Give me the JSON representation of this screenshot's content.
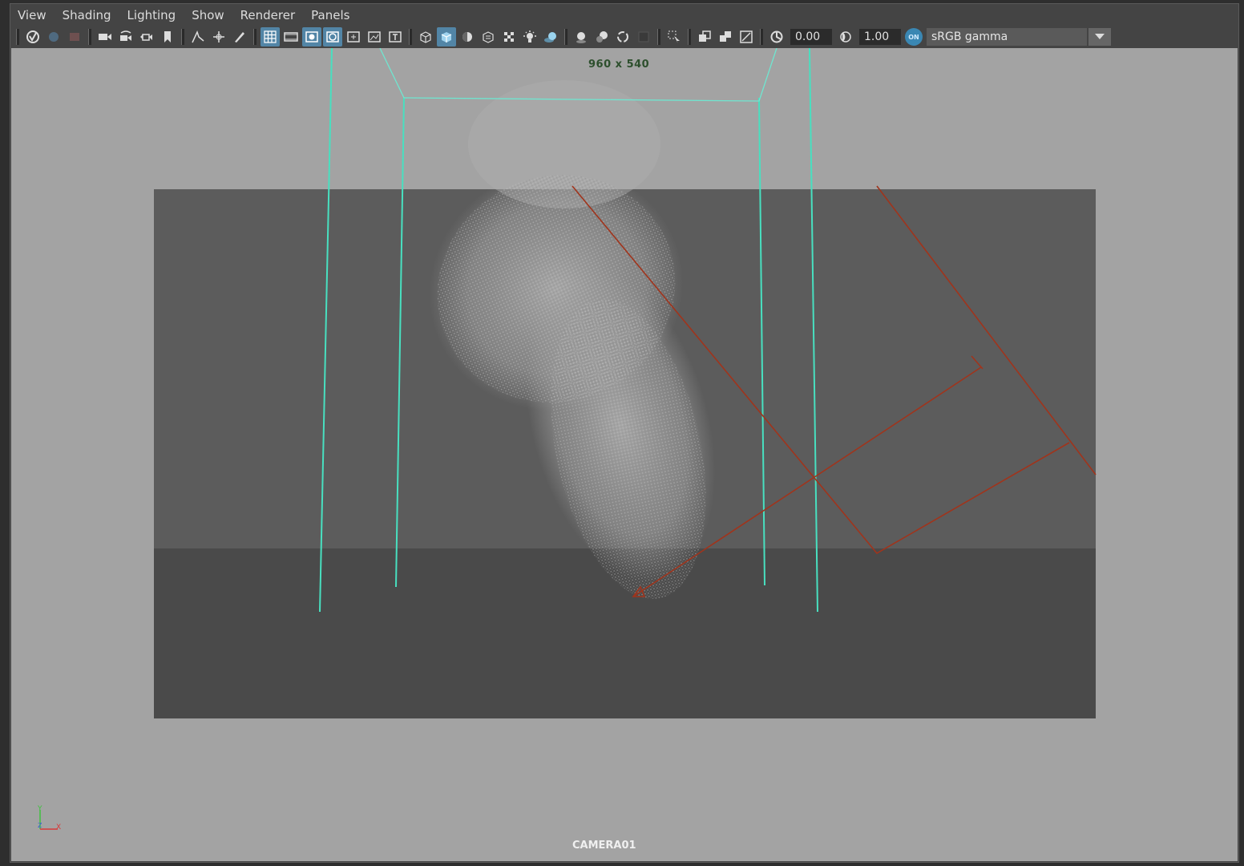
{
  "menu": {
    "items": [
      "View",
      "Shading",
      "Lighting",
      "Show",
      "Renderer",
      "Panels"
    ]
  },
  "toolbar": {
    "exposure_value": "0.00",
    "gamma_value": "1.00",
    "color_management_label": "sRGB gamma",
    "color_management_toggle_label": "ON"
  },
  "viewport": {
    "resolution_label": "960 x 540",
    "camera_name": "CAMERA01",
    "axis_labels": {
      "y": "Y",
      "z": "Z",
      "x": "X"
    },
    "colors": {
      "background": "#a3a3a3",
      "gate_upper": "#5c5c5c",
      "gate_lower": "#4a4a4a",
      "wireframe_cyan": "#48e0c0",
      "locator_red": "#a0341c",
      "particles": "#a8a8a8"
    }
  },
  "icons": [
    "select-camera-icon",
    "camera-attributes-icon",
    "bookmark-icon",
    "grid-icon",
    "film-gate-icon",
    "resolution-gate-icon",
    "gate-mask-icon",
    "field-chart-icon",
    "safe-action-icon",
    "safe-title-icon",
    "wireframe-icon",
    "smooth-shade-icon",
    "textured-icon",
    "lights-icon",
    "shadows-icon",
    "ambient-occlusion-icon",
    "isolate-select-icon",
    "xray-icon",
    "exposure-icon",
    "gamma-icon",
    "color-management-icon",
    "dropdown-arrow-icon"
  ]
}
